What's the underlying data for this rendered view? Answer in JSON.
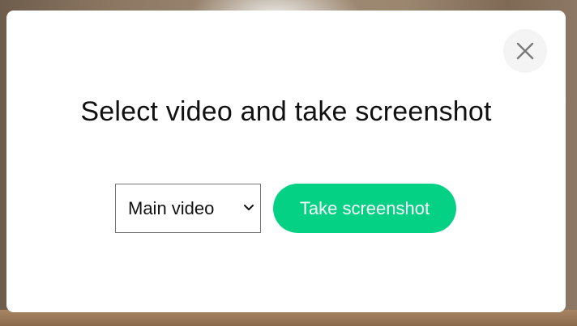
{
  "dialog": {
    "title": "Select video and take screenshot",
    "close_icon": "close-icon",
    "video_select": {
      "selected": "Main video",
      "icon": "chevron-down-icon"
    },
    "take_screenshot_label": "Take screenshot"
  },
  "colors": {
    "accent": "#05d184",
    "close_bg": "#f4f4f4",
    "text": "#111111"
  }
}
